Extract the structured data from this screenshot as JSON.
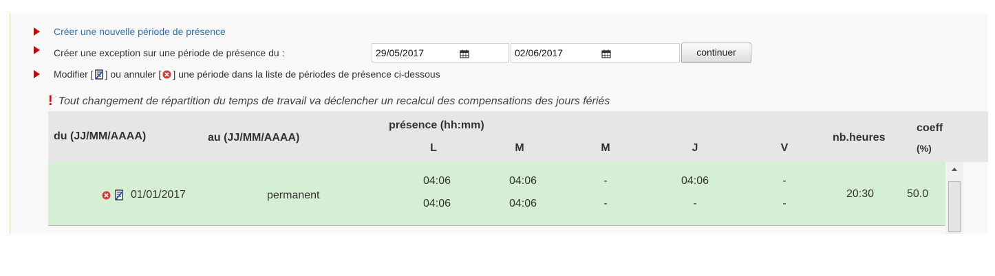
{
  "actions": {
    "create_label": "Créer une nouvelle période de présence",
    "exception_label": "Créer une exception sur une période de présence du :",
    "date_from": "29/05/2017",
    "date_to": "02/06/2017",
    "continue_label": "continuer",
    "modify_prefix": "Modifier [",
    "modify_middle": "] ou annuler [",
    "modify_suffix": "] une période dans la liste de périodes de présence ci-dessous"
  },
  "warning": {
    "mark": "!",
    "text": "Tout changement de répartition du temps de travail va déclencher un recalcul des compensations des jours fériés"
  },
  "table": {
    "headers": {
      "du": "du (JJ/MM/AAAA)",
      "au": "au (JJ/MM/AAAA)",
      "presence": "présence (hh:mm)",
      "days": [
        "L",
        "M",
        "M",
        "J",
        "V"
      ],
      "nbheures": "nb.heures",
      "coeff": "coeff",
      "coeff_unit": "(%)"
    },
    "rows": [
      {
        "du": "01/01/2017",
        "au": "permanent",
        "week1": [
          "04:06",
          "04:06",
          "-",
          "04:06",
          "-"
        ],
        "week2": [
          "04:06",
          "04:06",
          "-",
          "-",
          "-"
        ],
        "nbheures": "20:30",
        "coeff": "50.0"
      }
    ]
  },
  "colors": {
    "accent_arrow": "#d40000",
    "link": "#2a6fb3",
    "row_bg": "#d4efd4",
    "header_bg": "#e6e6e6"
  },
  "icons": [
    "arrow-right-icon",
    "calendar-icon",
    "edit-icon",
    "cancel-icon",
    "warning-icon"
  ]
}
